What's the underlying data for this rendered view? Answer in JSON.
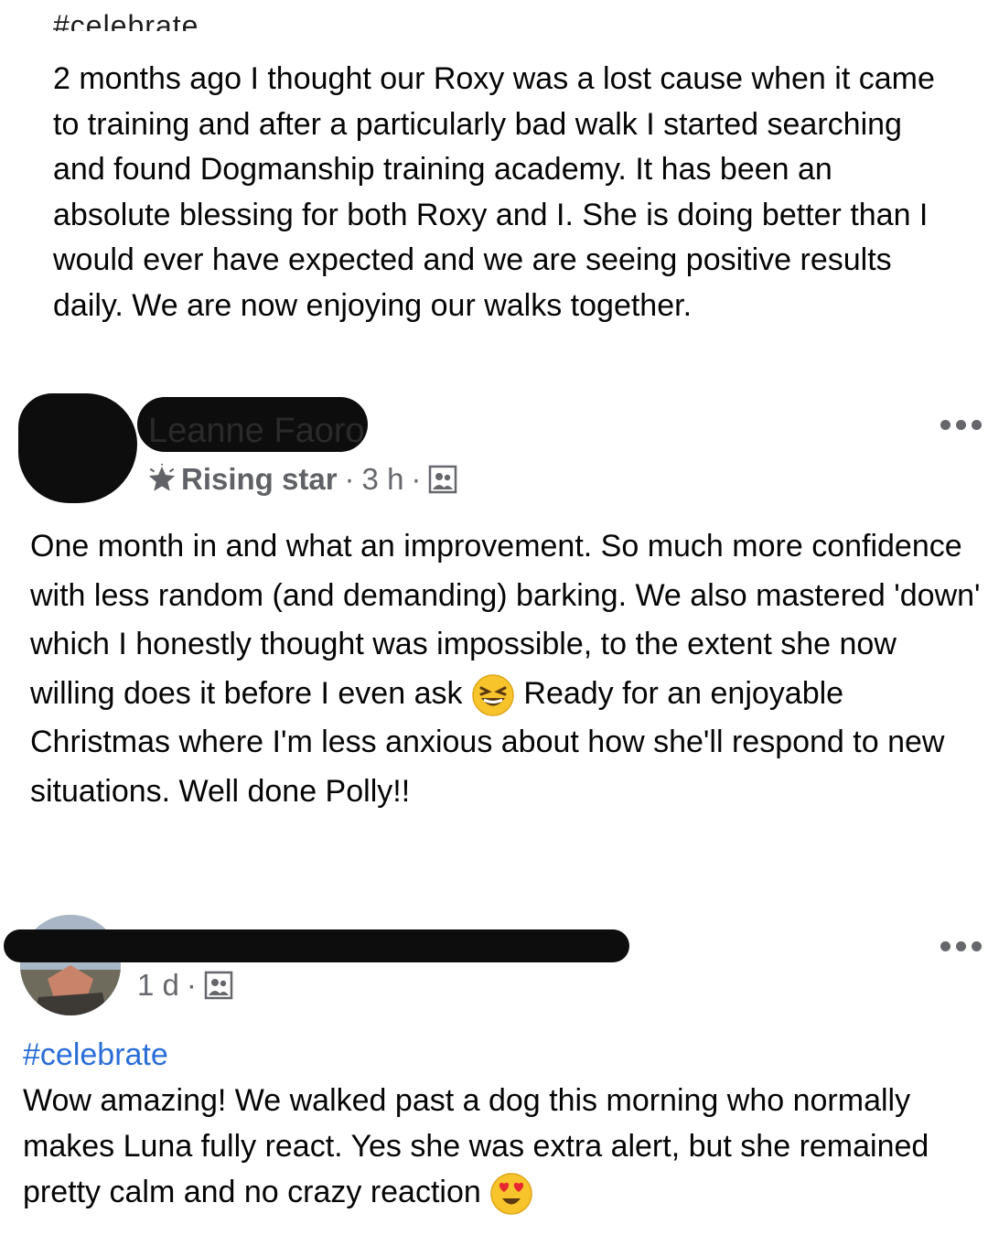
{
  "post_top": {
    "hashtag": "#celebrate",
    "body": "2 months ago I thought our Roxy was a lost cause when it came to training and after a particularly bad walk I started searching and found Dogmanship training academy. It has been an absolute blessing for both Roxy and I. She is doing better than I would ever have expected and we are seeing positive results daily. We are now enjoying our walks together."
  },
  "comment_1": {
    "author": "Leanne Faoro",
    "badge": "Rising star",
    "time": "3 h",
    "separator": "·",
    "body_part1": "One month in and what an improvement. So much more confidence with less random (and demanding) barking. We also mastered 'down' which I honestly thought was impossible, to the extent she now willing does it before I even ask",
    "body_part2": "Ready for an enjoyable Christmas where I'm less anxious about how she'll respond to new situations. Well done Polly!!",
    "emoji": "laughing-face-emoji",
    "icons": [
      "star-icon",
      "group-members-icon",
      "more-options-icon"
    ]
  },
  "comment_2": {
    "time": "1 d",
    "separator": "·",
    "hashtag": "#celebrate",
    "body": "Wow amazing! We walked past a dog this morning who normally makes Luna fully react. Yes she was extra alert, but she remained pretty calm and no crazy reaction",
    "emoji": "heart-eyes-emoji",
    "icons": [
      "group-members-icon",
      "more-options-icon"
    ]
  },
  "colors": {
    "text": "#050505",
    "meta": "#65676b",
    "link": "#2a6dd8",
    "redaction": "#0d0d0d"
  }
}
